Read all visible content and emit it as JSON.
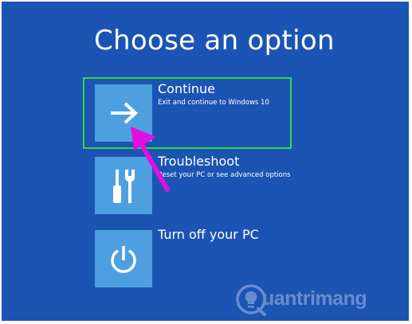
{
  "screen": {
    "title": "Choose an option",
    "background_color": "#1c54b4",
    "tile_color": "#4d9fe0"
  },
  "options": [
    {
      "label": "Continue",
      "description": "Exit and continue to Windows 10",
      "icon": "arrow-right-icon"
    },
    {
      "label": "Troubleshoot",
      "description": "Reset your PC or see advanced options",
      "icon": "tools-icon"
    },
    {
      "label": "Turn off your PC",
      "description": "",
      "icon": "power-icon"
    }
  ],
  "annotation": {
    "highlight_color": "#2ddc3f",
    "arrow_color": "#e010e0",
    "highlighted_option": "Continue"
  },
  "watermark": {
    "text": "uantrimang",
    "icon": "lightbulb-icon"
  }
}
